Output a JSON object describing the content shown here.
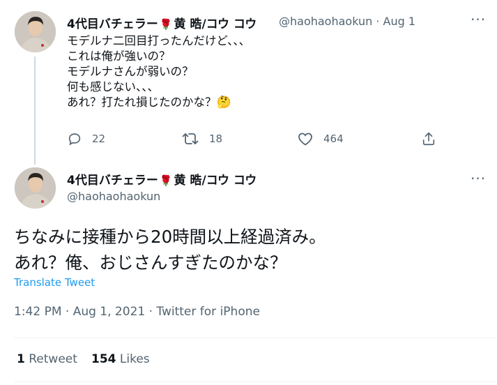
{
  "parent_tweet": {
    "author_name": "4代目バチェラー",
    "author_name_suffix": "黄 晧/コウ コウ",
    "rose_emoji": "🌹",
    "handle": "@haohaohaokun",
    "separator": "·",
    "date": "Aug 1",
    "more": "···",
    "lines": [
      "モデルナ二回目打ったんだけど、、、",
      "これは俺が強いの？",
      "モデルナさんが弱いの？",
      "何も感じない、、、",
      "あれ？打たれ損じたのかな？"
    ],
    "thinking_emoji": "🤔",
    "actions": {
      "reply_count": "22",
      "retweet_count": "18",
      "like_count": "464"
    }
  },
  "main_tweet": {
    "author_name": "4代目バチェラー",
    "author_name_suffix": "黄 晧/コウ コウ",
    "rose_emoji": "🌹",
    "handle": "@haohaohaokun",
    "more": "···",
    "lines": [
      "ちなみに接種から20時間以上経過済み。",
      "あれ？俺、おじさんすぎたのかな？"
    ],
    "translate_label": "Translate Tweet",
    "timestamp": "1:42 PM · Aug 1, 2021 · Twitter for iPhone",
    "retweets_count": "1",
    "retweets_label": "Retweet",
    "likes_count": "154",
    "likes_label": "Likes"
  },
  "colors": {
    "accent": "#1d9bf0",
    "secondary_text": "#536471",
    "rose": "#c0172a"
  },
  "icons": [
    "reply-icon",
    "retweet-icon",
    "like-icon",
    "share-icon",
    "more-icon",
    "rose-icon",
    "thinking-face-icon"
  ]
}
